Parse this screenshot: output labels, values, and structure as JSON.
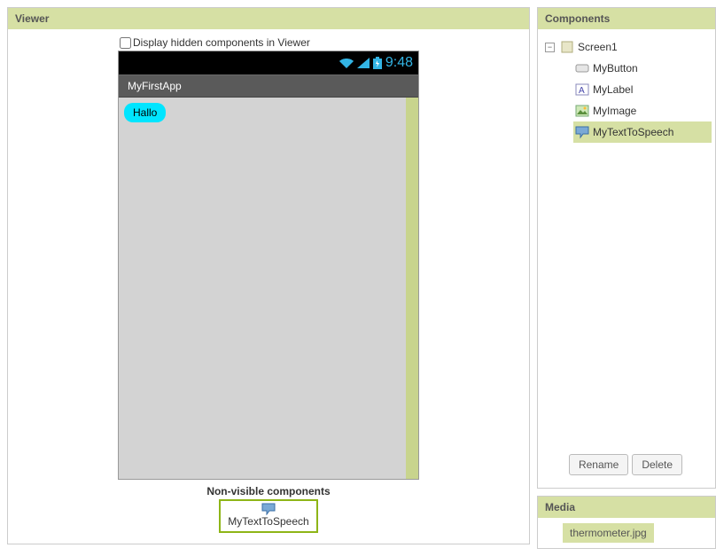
{
  "viewer": {
    "title": "Viewer",
    "hidden_toggle_label": "Display hidden components in Viewer",
    "nonvisible_label": "Non-visible components",
    "nonvisible_component": "MyTextToSpeech"
  },
  "phone": {
    "time": "9:48",
    "app_title": "MyFirstApp",
    "button_label": "Hallo"
  },
  "components": {
    "title": "Components",
    "tree": {
      "root": "Screen1",
      "children": [
        "MyButton",
        "MyLabel",
        "MyImage",
        "MyTextToSpeech"
      ],
      "selected": "MyTextToSpeech"
    },
    "rename_label": "Rename",
    "delete_label": "Delete"
  },
  "media": {
    "title": "Media",
    "items": [
      "thermometer.jpg"
    ]
  }
}
